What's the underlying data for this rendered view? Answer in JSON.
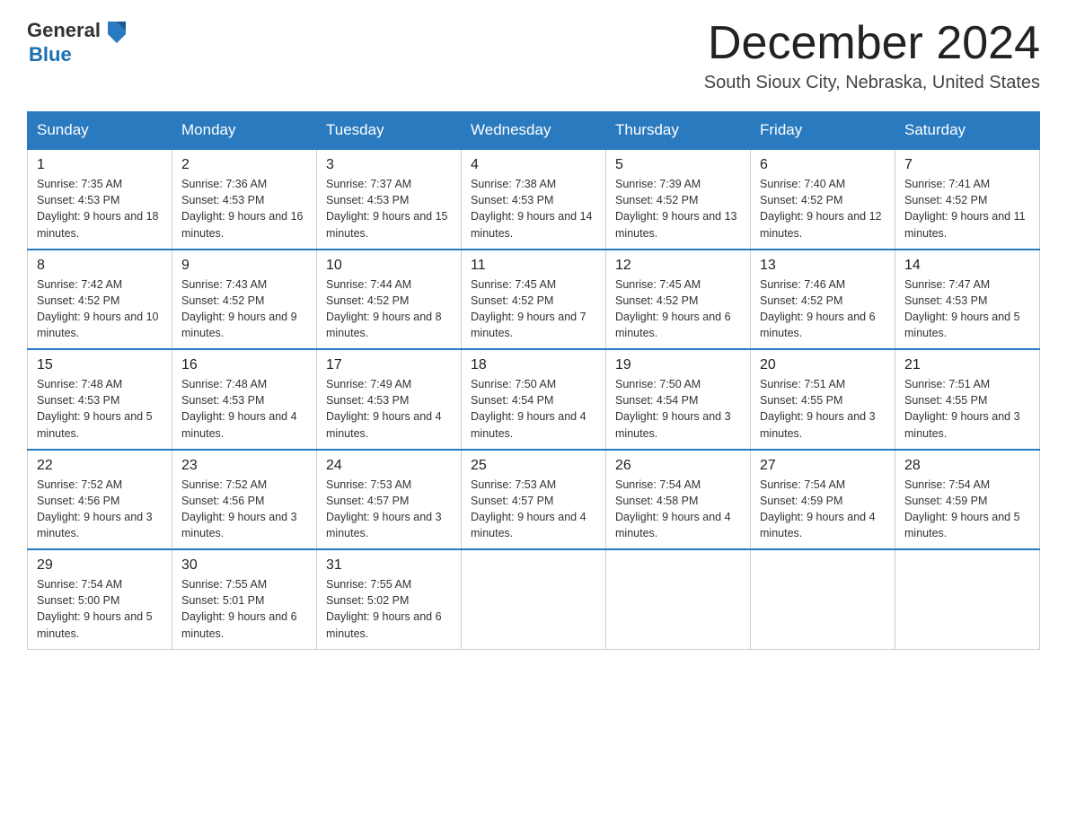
{
  "header": {
    "logo_general": "General",
    "logo_blue": "Blue",
    "month_title": "December 2024",
    "location": "South Sioux City, Nebraska, United States"
  },
  "weekdays": [
    "Sunday",
    "Monday",
    "Tuesday",
    "Wednesday",
    "Thursday",
    "Friday",
    "Saturday"
  ],
  "weeks": [
    [
      {
        "day": "1",
        "sunrise": "7:35 AM",
        "sunset": "4:53 PM",
        "daylight": "9 hours and 18 minutes."
      },
      {
        "day": "2",
        "sunrise": "7:36 AM",
        "sunset": "4:53 PM",
        "daylight": "9 hours and 16 minutes."
      },
      {
        "day": "3",
        "sunrise": "7:37 AM",
        "sunset": "4:53 PM",
        "daylight": "9 hours and 15 minutes."
      },
      {
        "day": "4",
        "sunrise": "7:38 AM",
        "sunset": "4:53 PM",
        "daylight": "9 hours and 14 minutes."
      },
      {
        "day": "5",
        "sunrise": "7:39 AM",
        "sunset": "4:52 PM",
        "daylight": "9 hours and 13 minutes."
      },
      {
        "day": "6",
        "sunrise": "7:40 AM",
        "sunset": "4:52 PM",
        "daylight": "9 hours and 12 minutes."
      },
      {
        "day": "7",
        "sunrise": "7:41 AM",
        "sunset": "4:52 PM",
        "daylight": "9 hours and 11 minutes."
      }
    ],
    [
      {
        "day": "8",
        "sunrise": "7:42 AM",
        "sunset": "4:52 PM",
        "daylight": "9 hours and 10 minutes."
      },
      {
        "day": "9",
        "sunrise": "7:43 AM",
        "sunset": "4:52 PM",
        "daylight": "9 hours and 9 minutes."
      },
      {
        "day": "10",
        "sunrise": "7:44 AM",
        "sunset": "4:52 PM",
        "daylight": "9 hours and 8 minutes."
      },
      {
        "day": "11",
        "sunrise": "7:45 AM",
        "sunset": "4:52 PM",
        "daylight": "9 hours and 7 minutes."
      },
      {
        "day": "12",
        "sunrise": "7:45 AM",
        "sunset": "4:52 PM",
        "daylight": "9 hours and 6 minutes."
      },
      {
        "day": "13",
        "sunrise": "7:46 AM",
        "sunset": "4:52 PM",
        "daylight": "9 hours and 6 minutes."
      },
      {
        "day": "14",
        "sunrise": "7:47 AM",
        "sunset": "4:53 PM",
        "daylight": "9 hours and 5 minutes."
      }
    ],
    [
      {
        "day": "15",
        "sunrise": "7:48 AM",
        "sunset": "4:53 PM",
        "daylight": "9 hours and 5 minutes."
      },
      {
        "day": "16",
        "sunrise": "7:48 AM",
        "sunset": "4:53 PM",
        "daylight": "9 hours and 4 minutes."
      },
      {
        "day": "17",
        "sunrise": "7:49 AM",
        "sunset": "4:53 PM",
        "daylight": "9 hours and 4 minutes."
      },
      {
        "day": "18",
        "sunrise": "7:50 AM",
        "sunset": "4:54 PM",
        "daylight": "9 hours and 4 minutes."
      },
      {
        "day": "19",
        "sunrise": "7:50 AM",
        "sunset": "4:54 PM",
        "daylight": "9 hours and 3 minutes."
      },
      {
        "day": "20",
        "sunrise": "7:51 AM",
        "sunset": "4:55 PM",
        "daylight": "9 hours and 3 minutes."
      },
      {
        "day": "21",
        "sunrise": "7:51 AM",
        "sunset": "4:55 PM",
        "daylight": "9 hours and 3 minutes."
      }
    ],
    [
      {
        "day": "22",
        "sunrise": "7:52 AM",
        "sunset": "4:56 PM",
        "daylight": "9 hours and 3 minutes."
      },
      {
        "day": "23",
        "sunrise": "7:52 AM",
        "sunset": "4:56 PM",
        "daylight": "9 hours and 3 minutes."
      },
      {
        "day": "24",
        "sunrise": "7:53 AM",
        "sunset": "4:57 PM",
        "daylight": "9 hours and 3 minutes."
      },
      {
        "day": "25",
        "sunrise": "7:53 AM",
        "sunset": "4:57 PM",
        "daylight": "9 hours and 4 minutes."
      },
      {
        "day": "26",
        "sunrise": "7:54 AM",
        "sunset": "4:58 PM",
        "daylight": "9 hours and 4 minutes."
      },
      {
        "day": "27",
        "sunrise": "7:54 AM",
        "sunset": "4:59 PM",
        "daylight": "9 hours and 4 minutes."
      },
      {
        "day": "28",
        "sunrise": "7:54 AM",
        "sunset": "4:59 PM",
        "daylight": "9 hours and 5 minutes."
      }
    ],
    [
      {
        "day": "29",
        "sunrise": "7:54 AM",
        "sunset": "5:00 PM",
        "daylight": "9 hours and 5 minutes."
      },
      {
        "day": "30",
        "sunrise": "7:55 AM",
        "sunset": "5:01 PM",
        "daylight": "9 hours and 6 minutes."
      },
      {
        "day": "31",
        "sunrise": "7:55 AM",
        "sunset": "5:02 PM",
        "daylight": "9 hours and 6 minutes."
      },
      null,
      null,
      null,
      null
    ]
  ]
}
